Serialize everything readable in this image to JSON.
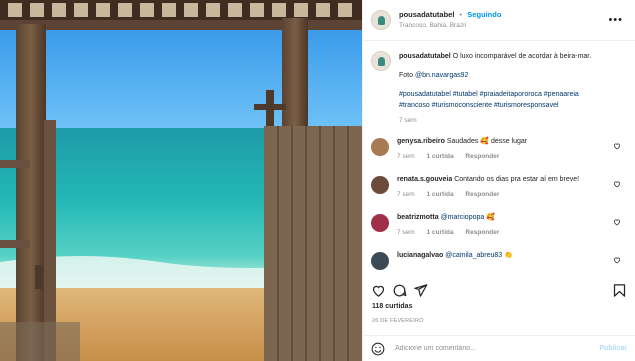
{
  "header": {
    "username": "pousadatutabel",
    "separator": "•",
    "follow_label": "Seguindo",
    "location": "Trancoso, Bahia, Brazil",
    "more_icon": "more-horizontal-icon"
  },
  "caption": {
    "username": "pousadatutabel",
    "text": "O luxo incomparável de acordar à beira-mar.",
    "photo_prefix": "Foto",
    "photo_credit": "@bn.navargas92",
    "hashtags_line1": "#pousadatutabel #tutabel #praiadeitapororoca #penaareia",
    "hashtags_line2": "#trancoso #turismoconsciente #turismoresponsavel",
    "time": "7 sem"
  },
  "comments": [
    {
      "username": "genysa.ribeiro",
      "text": "Saudades 🥰 desse lugar",
      "time": "7 sem",
      "likes": "1 curtida",
      "reply": "Responder",
      "avatar_color": "#a87a52"
    },
    {
      "username": "renata.s.gouveia",
      "text": "Contando os dias pra estar aí em breve!",
      "time": "7 sem",
      "likes": "1 curtida",
      "reply": "Responder",
      "avatar_color": "#6b4a3a"
    },
    {
      "username": "beatrizmotta",
      "mention": "@marciopopa",
      "text": "🥰",
      "time": "7 sem",
      "likes": "1 curtida",
      "reply": "Responder",
      "avatar_color": "#a0304a"
    },
    {
      "username": "lucianagalvao",
      "mention": "@camila_abreu83",
      "text": "👏",
      "avatar_color": "#3c4a55"
    }
  ],
  "actions": {
    "icons": [
      "heart-icon",
      "comment-icon",
      "share-icon",
      "bookmark-icon"
    ]
  },
  "likes": "118 curtidas",
  "date": "26 DE FEVEREIRO",
  "add_comment": {
    "placeholder": "Adicione um comentário...",
    "publish_label": "Publicar"
  }
}
